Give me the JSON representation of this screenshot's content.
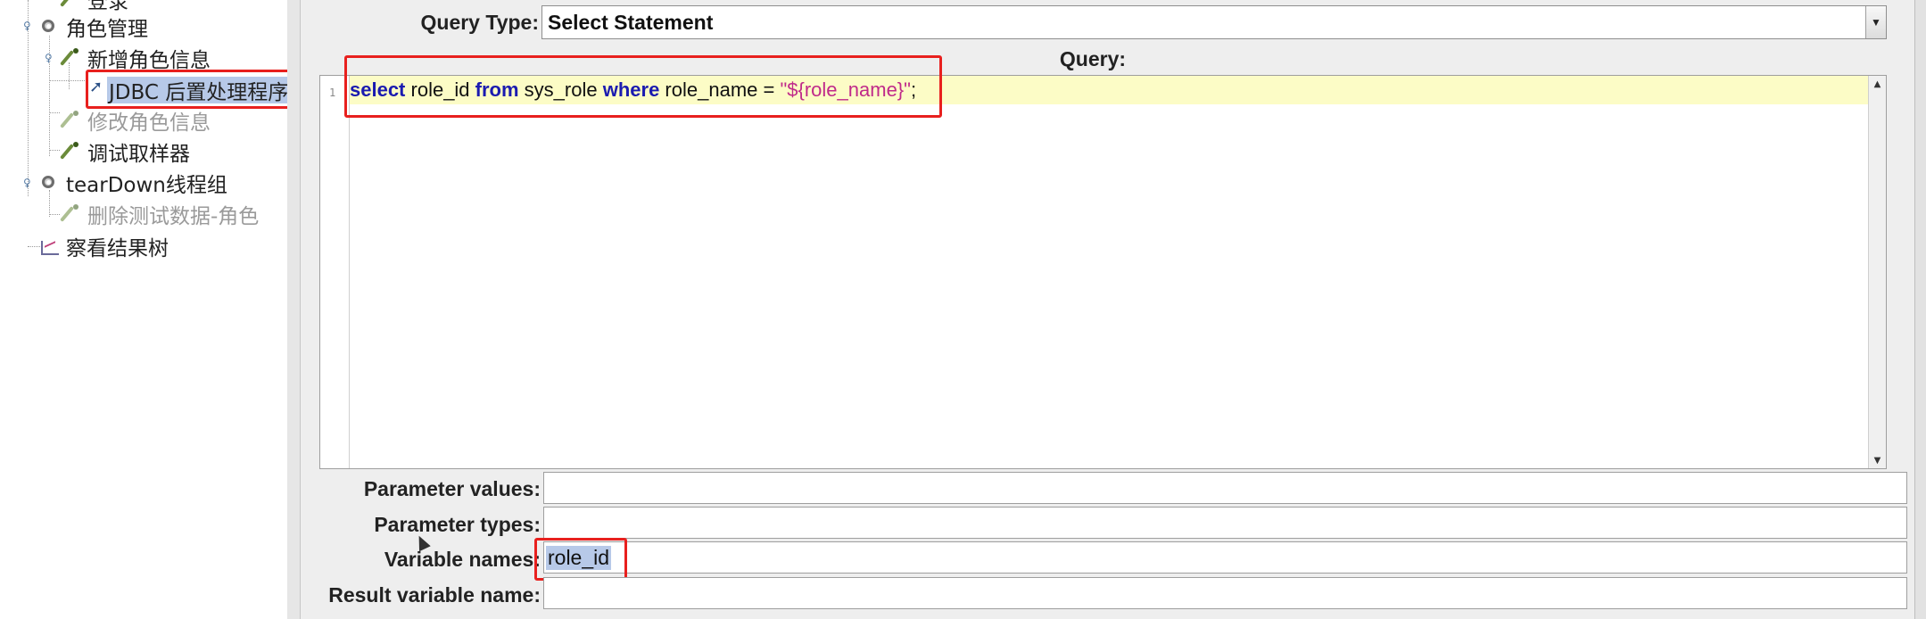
{
  "tree": {
    "items": [
      {
        "label": "登录",
        "disabled": false
      },
      {
        "label": "角色管理"
      },
      {
        "label": "新增角色信息"
      },
      {
        "label": "JDBC 后置处理程序"
      },
      {
        "label": "修改角色信息"
      },
      {
        "label": "调试取样器"
      },
      {
        "label": "tearDown线程组"
      },
      {
        "label": "删除测试数据-角色"
      },
      {
        "label": "察看结果树"
      }
    ]
  },
  "form": {
    "query_type_label": "Query Type:",
    "query_type_value": "Select Statement",
    "query_label": "Query:",
    "line_number": "1",
    "sql": {
      "kw_select": "select",
      "t1": " role_id ",
      "kw_from": "from",
      "t2": " sys_role ",
      "kw_where": "where",
      "t3": " role_name = ",
      "str_value": "\"${role_name}\"",
      "t4": ";"
    },
    "parameter_values_label": "Parameter values:",
    "parameter_values": "",
    "parameter_types_label": "Parameter types:",
    "parameter_types": "",
    "variable_names_label": "Variable names:",
    "variable_names": "role_id",
    "result_variable_name_label": "Result variable name:",
    "result_variable_name": ""
  },
  "colors": {
    "highlight_box": "#e8201e",
    "selection": "#b7c9e8",
    "current_line": "#fcfcc6",
    "keyword": "#1b1bb0",
    "string": "#c02a8a"
  }
}
